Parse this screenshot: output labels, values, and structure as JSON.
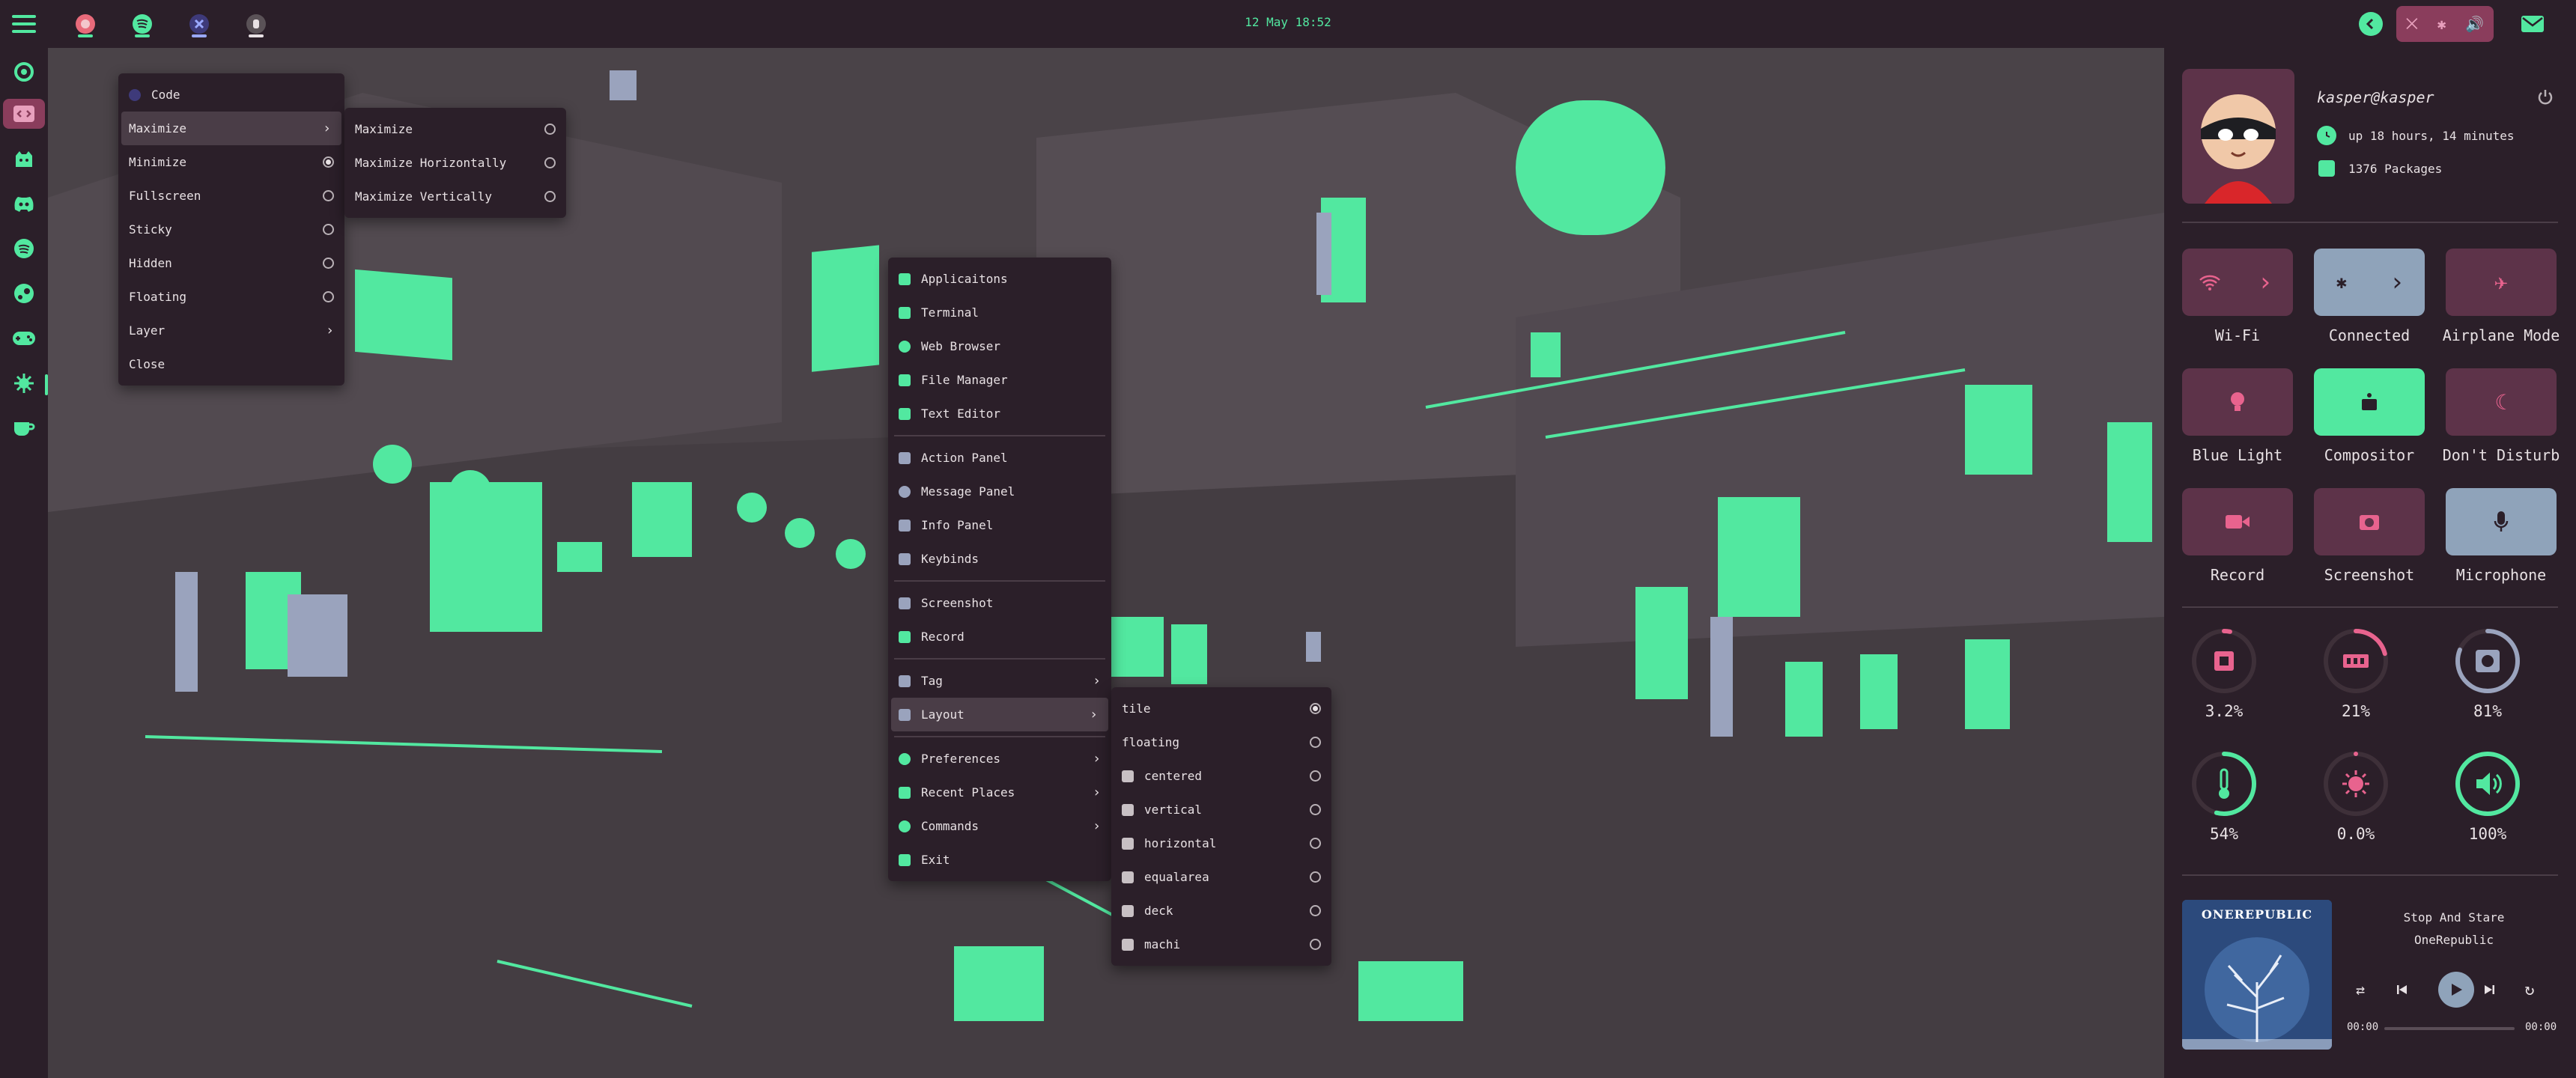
{
  "topbar": {
    "clock": "12 May 18:52",
    "apps": [
      {
        "name": "firefox-icon",
        "color": "#e86a7a"
      },
      {
        "name": "spotify-icon",
        "color": "#52e8a0"
      },
      {
        "name": "vscode-icon",
        "color": "#6a7ae8"
      },
      {
        "name": "shell-icon",
        "color": "#c8c0c4"
      }
    ]
  },
  "dock": {
    "items": [
      "firefox-icon",
      "code-icon",
      "github-icon",
      "discord-icon",
      "spotify-icon",
      "steam-icon",
      "gamepad-icon",
      "settings-icon",
      "coffee-icon"
    ]
  },
  "window_menu": {
    "title": "Code",
    "items": [
      {
        "label": "Maximize",
        "type": "submenu",
        "highlight": true
      },
      {
        "label": "Minimize",
        "type": "radio",
        "checked": true
      },
      {
        "label": "Fullscreen",
        "type": "radio",
        "checked": false
      },
      {
        "label": "Sticky",
        "type": "radio",
        "checked": false
      },
      {
        "label": "Hidden",
        "type": "radio",
        "checked": false
      },
      {
        "label": "Floating",
        "type": "radio",
        "checked": false
      },
      {
        "label": "Layer",
        "type": "submenu"
      },
      {
        "label": "Close",
        "type": "plain"
      }
    ]
  },
  "maximize_menu": {
    "items": [
      "Maximize",
      "Maximize Horizontally",
      "Maximize Vertically"
    ]
  },
  "main_menu": {
    "group1": [
      "Applicaitons",
      "Terminal",
      "Web Browser",
      "File Manager",
      "Text Editor"
    ],
    "group2": [
      "Action Panel",
      "Message Panel",
      "Info Panel",
      "Keybinds"
    ],
    "group3": [
      "Screenshot",
      "Record"
    ],
    "group4": [
      {
        "label": "Tag",
        "submenu": true
      },
      {
        "label": "Layout",
        "submenu": true,
        "highlight": true
      }
    ],
    "group5": [
      {
        "label": "Preferences",
        "submenu": true
      },
      {
        "label": "Recent Places",
        "submenu": true
      },
      {
        "label": "Commands",
        "submenu": true
      },
      {
        "label": "Exit",
        "submenu": false
      }
    ]
  },
  "layout_menu": {
    "items": [
      {
        "label": "tile",
        "checked": true
      },
      {
        "label": "floating",
        "checked": false
      },
      {
        "label": "centered",
        "checked": false
      },
      {
        "label": "vertical",
        "checked": false
      },
      {
        "label": "horizontal",
        "checked": false
      },
      {
        "label": "equalarea",
        "checked": false
      },
      {
        "label": "deck",
        "checked": false
      },
      {
        "label": "machi",
        "checked": false
      }
    ]
  },
  "profile": {
    "user": "kasper@kasper",
    "uptime": "up 18 hours, 14 minutes",
    "packages": "1376 Packages"
  },
  "quick_settings": [
    {
      "label": "Wi-Fi",
      "active": false,
      "icon": "wifi-icon"
    },
    {
      "label": "Connected",
      "active": true,
      "icon": "bluetooth-icon"
    },
    {
      "label": "Airplane Mode",
      "active": false,
      "icon": "airplane-icon"
    },
    {
      "label": "Blue Light",
      "active": false,
      "icon": "bulb-icon"
    },
    {
      "label": "Compositor",
      "active": true,
      "icon": "compositor-icon"
    },
    {
      "label": "Don't Disturb",
      "active": false,
      "icon": "moon-icon"
    },
    {
      "label": "Record",
      "active": false,
      "icon": "record-icon"
    },
    {
      "label": "Screenshot",
      "active": false,
      "icon": "camera-icon"
    },
    {
      "label": "Microphone",
      "active": true,
      "icon": "mic-icon"
    }
  ],
  "stats": [
    {
      "label": "3.2%",
      "value": 0.032,
      "icon": "cpu-icon",
      "color": "#e8638e"
    },
    {
      "label": "21%",
      "value": 0.21,
      "icon": "ram-icon",
      "color": "#e8638e"
    },
    {
      "label": "81%",
      "value": 0.81,
      "icon": "disk-icon",
      "color": "#9aa3bd"
    },
    {
      "label": "54%",
      "value": 0.54,
      "icon": "temperature-icon",
      "color": "#52e8a0"
    },
    {
      "label": "0.0%",
      "value": 0.0,
      "icon": "brightness-icon",
      "color": "#e8638e"
    },
    {
      "label": "100%",
      "value": 1.0,
      "icon": "volume-icon",
      "color": "#52e8a0"
    }
  ],
  "music": {
    "title": "Stop And Stare",
    "artist": "OneRepublic",
    "album_art_text": "ONEREPUBLIC",
    "elapsed": "00:00",
    "total": "00:00",
    "progress": 0
  },
  "colors": {
    "accent": "#52e8a0",
    "pink": "#e8638e",
    "bg": "#2b1f29",
    "tile": "#5d3349",
    "tile_active": "#8fa3ba"
  }
}
